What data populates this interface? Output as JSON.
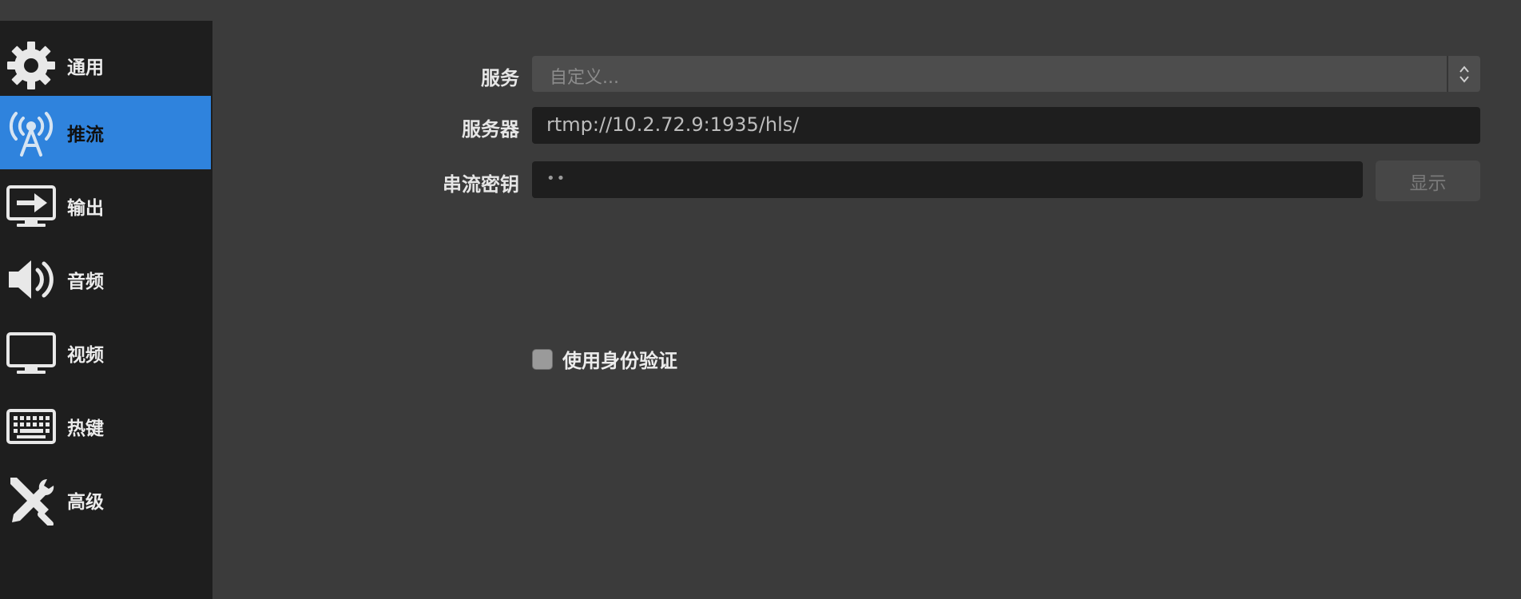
{
  "sidebar": {
    "items": [
      {
        "label": "通用",
        "icon": "gear-icon",
        "active": false
      },
      {
        "label": "推流",
        "icon": "broadcast-tower-icon",
        "active": true
      },
      {
        "label": "输出",
        "icon": "monitor-output-icon",
        "active": false
      },
      {
        "label": "音频",
        "icon": "speaker-icon",
        "active": false
      },
      {
        "label": "视频",
        "icon": "monitor-icon",
        "active": false
      },
      {
        "label": "热键",
        "icon": "keyboard-icon",
        "active": false
      },
      {
        "label": "高级",
        "icon": "tools-icon",
        "active": false
      }
    ]
  },
  "form": {
    "service_label": "服务",
    "service_value": "自定义...",
    "server_label": "服务器",
    "server_value": "rtmp://10.2.72.9:1935/hls/",
    "key_label": "串流密钥",
    "key_value": "••",
    "show_button": "显示",
    "auth_checkbox_label": "使用身份验证",
    "auth_checked": false
  },
  "colors": {
    "accent": "#2f83dd",
    "sidebar_bg": "#1e1e1e",
    "content_bg": "#3b3b3b",
    "field_bg": "#1e1e1e",
    "select_bg": "#4d4d4d"
  }
}
